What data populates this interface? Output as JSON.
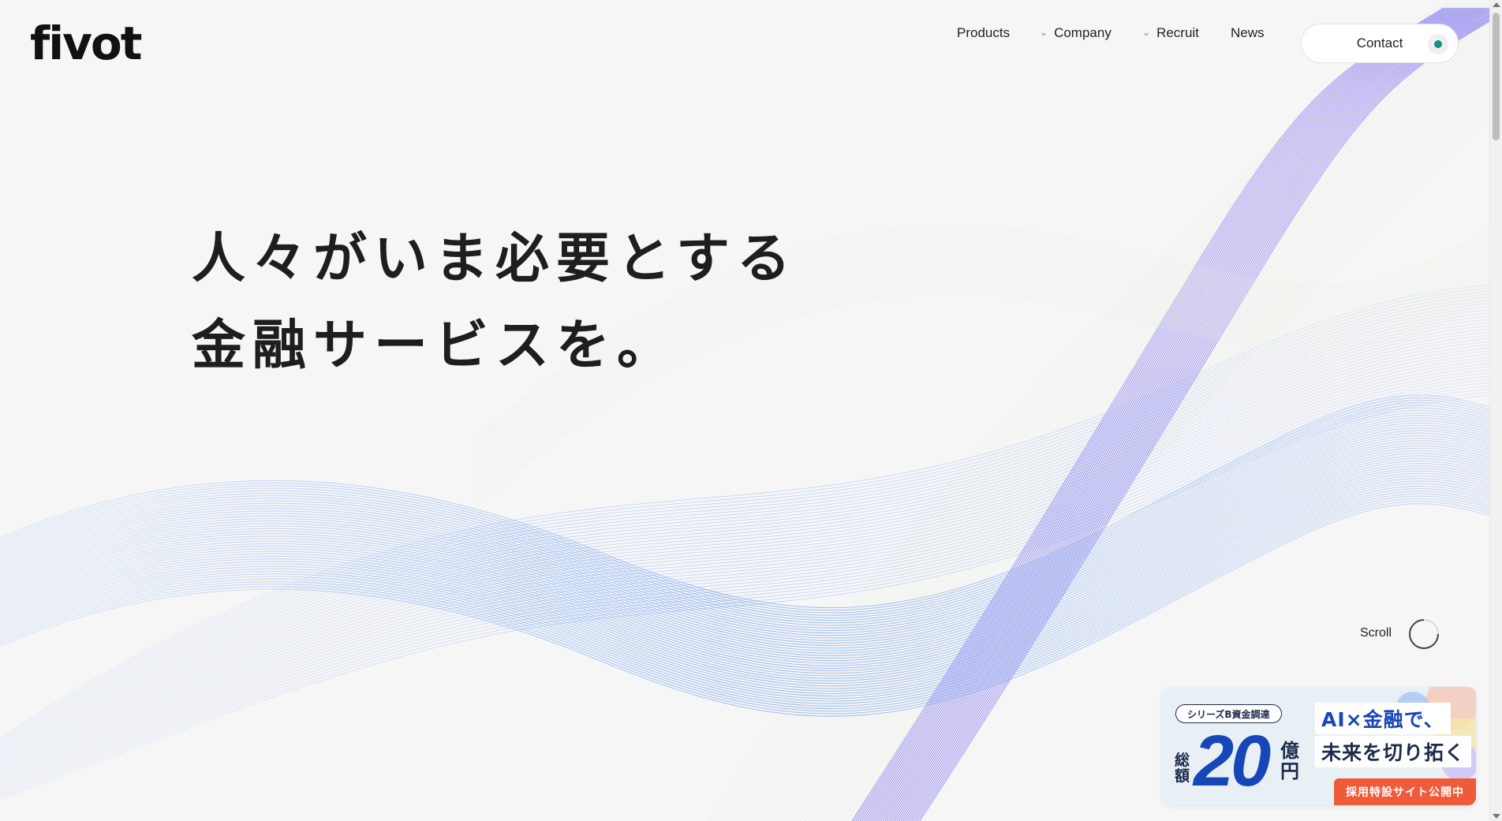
{
  "header": {
    "logo": "fivot",
    "nav": [
      {
        "label": "Products",
        "has_dropdown": false
      },
      {
        "label": "Company",
        "has_dropdown": true
      },
      {
        "label": "Recruit",
        "has_dropdown": true
      },
      {
        "label": "News",
        "has_dropdown": false
      }
    ],
    "contact_label": "Contact"
  },
  "hero": {
    "line1": "人々がいま必要とする",
    "line2": "金融サービスを。"
  },
  "scroll": {
    "label": "Scroll"
  },
  "banner": {
    "pill": "シリーズB資金調達",
    "sougaku": "総額",
    "amount": "20",
    "unit": "億円",
    "headline1": "AI×金融で、",
    "headline2": "未来を切り拓く",
    "cta": "採用特設サイト公開中"
  },
  "colors": {
    "background": "#f6f6f6",
    "accent": "#14908a",
    "banner_blue": "#1746b8",
    "banner_cta": "#ef5a3a",
    "wave_violet": "#8a6cf0",
    "wave_blue": "#5b8ff2"
  }
}
